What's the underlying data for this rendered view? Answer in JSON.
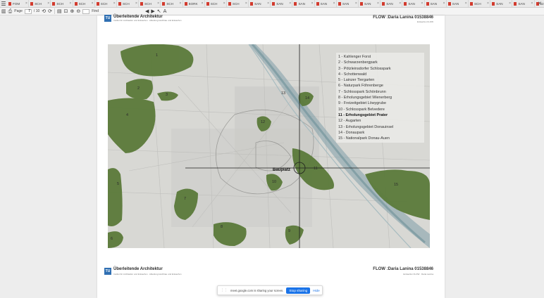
{
  "tabs": [
    {
      "label": "FOM"
    },
    {
      "label": "SCH"
    },
    {
      "label": "SCH"
    },
    {
      "label": "SCH"
    },
    {
      "label": "SCH"
    },
    {
      "label": "SCH"
    },
    {
      "label": "SCH"
    },
    {
      "label": "SCH"
    },
    {
      "label": "BORK"
    },
    {
      "label": "SCH"
    },
    {
      "label": "SCH"
    },
    {
      "label": "SAN"
    },
    {
      "label": "SAN"
    },
    {
      "label": "SAN"
    },
    {
      "label": "SAN"
    },
    {
      "label": "SAN"
    },
    {
      "label": "SAN"
    },
    {
      "label": "SAN"
    },
    {
      "label": "SAN"
    },
    {
      "label": "SAN"
    },
    {
      "label": "SAN"
    },
    {
      "label": "SCH"
    },
    {
      "label": "SAN"
    },
    {
      "label": "SAN"
    },
    {
      "label": "223"
    }
  ],
  "toolbar": {
    "page_label": "Page",
    "page_value": "7",
    "page_total": "/ 10",
    "find_label": "Find"
  },
  "document": {
    "header_title": "Überleitende Architektur",
    "header_subtitle": "Institut für Architektur und Entwerfen · Abteilung Hochbau und Entwerfen",
    "header_right": "FLOW :Daria Lanina 01538846",
    "header_right_sub": "Entwerfen FLOW",
    "logo_text": "TU",
    "footer_title": "Überleitende Architektur",
    "footer_subtitle": "Institut für Architektur und Entwerfen · Abteilung Hochbau und Entwerfen",
    "footer_right": "FLOW :Daria Lanina 01538846",
    "footer_right_sub": "Entwerfen FLOW · Daria Lanina"
  },
  "map": {
    "bauplatz_label": "Bauplatz",
    "legend": [
      "1 - Kahlenger Forst",
      "2 - Schwarzenbergpark",
      "3 - Pötzleinsdorfer Schlosspark",
      "4 - Schottenwald",
      "5 - Lainzer Tiergarten",
      "6 - Naturpark Föhrenberge",
      "7 - Schlosspark Schönbrunn",
      "8 - Erholungsgebiet Wienerberg",
      "9 - Freizeitgebiet Löwygrube",
      "10 - Schlosspark Belvedere",
      "11 - Erholungsgebiet Prater",
      "12 - Augarten",
      "13 - Erholungsgebiet Donauinsel",
      "14 - Donaupark",
      "15 - Nationalpark Donau-Auen"
    ],
    "highlight_index": 10,
    "numbers": [
      "1",
      "2",
      "3",
      "4",
      "5",
      "6",
      "7",
      "8",
      "9",
      "10",
      "11",
      "12",
      "13",
      "14",
      "15"
    ],
    "green_color": "#5b7a3a"
  },
  "share_bar": {
    "message": "meet.google.com is sharing your screen.",
    "stop_label": "Stop sharing",
    "hide_label": "Hide"
  }
}
